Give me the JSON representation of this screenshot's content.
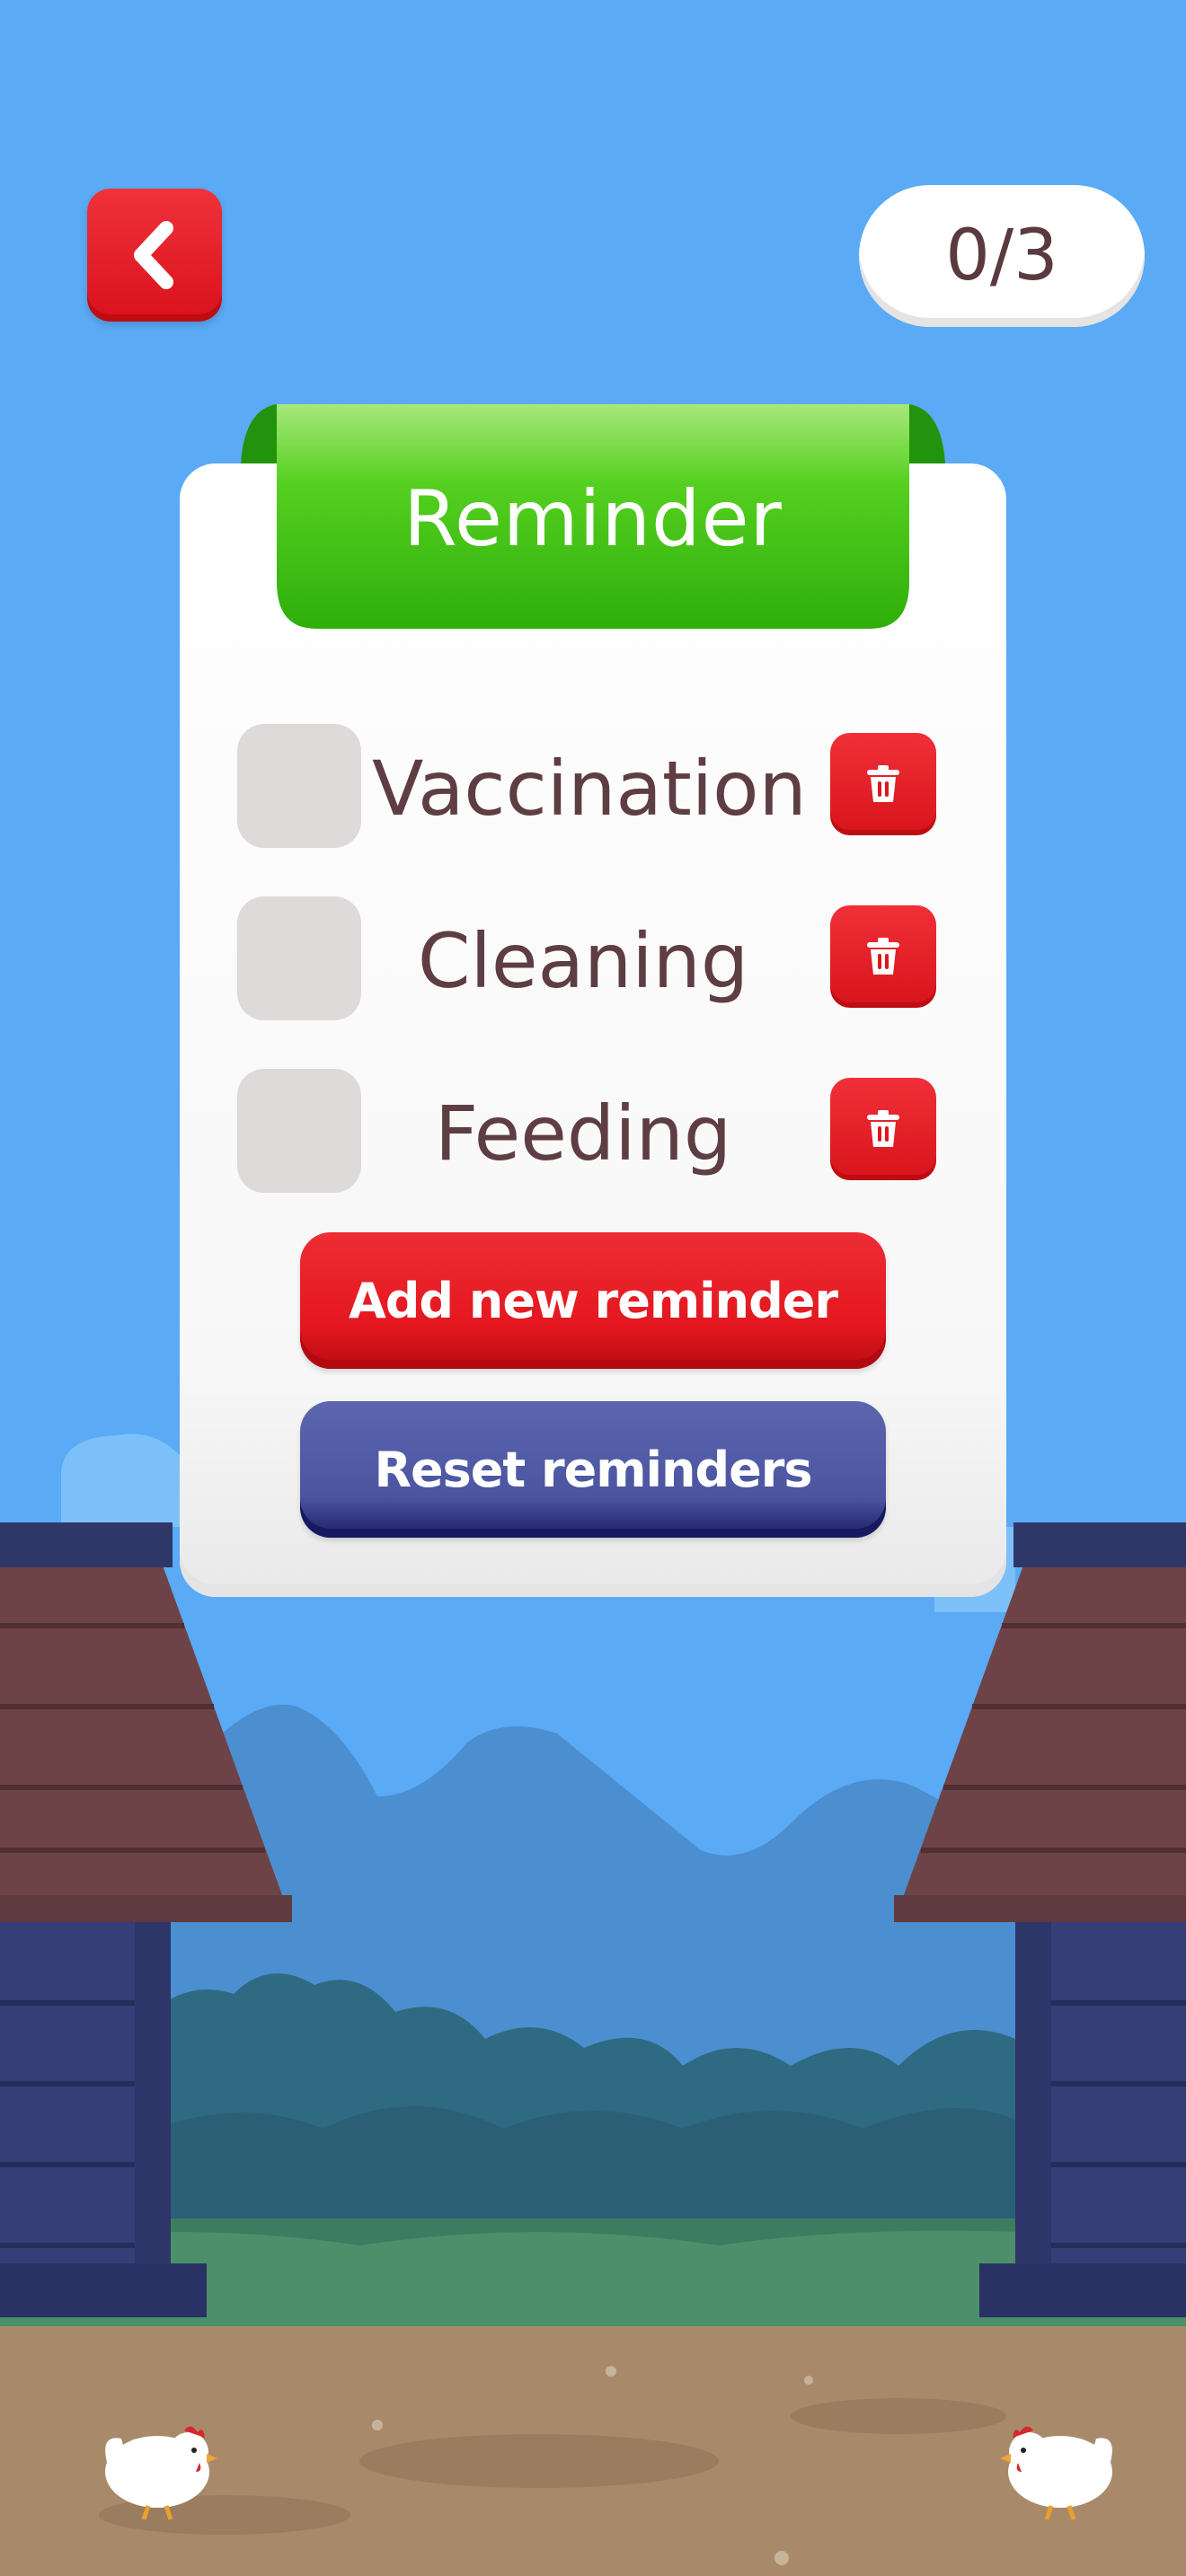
{
  "header": {
    "back_icon": "chevron-left-icon",
    "progress_text": "0/3"
  },
  "card": {
    "title": "Reminder",
    "reminders": [
      {
        "label": "Vaccination",
        "checked": false,
        "delete_icon": "trash-icon"
      },
      {
        "label": "Cleaning",
        "checked": false,
        "delete_icon": "trash-icon"
      },
      {
        "label": "Feeding",
        "checked": false,
        "delete_icon": "trash-icon"
      }
    ],
    "add_button_label": "Add new reminder",
    "reset_button_label": "Reset reminders"
  },
  "colors": {
    "sky": "#5AAAF5",
    "banner_green": "#3CC30E",
    "accent_red": "#E3161F",
    "reset_blue": "#4B55A0",
    "text_brown": "#5E3D43"
  }
}
